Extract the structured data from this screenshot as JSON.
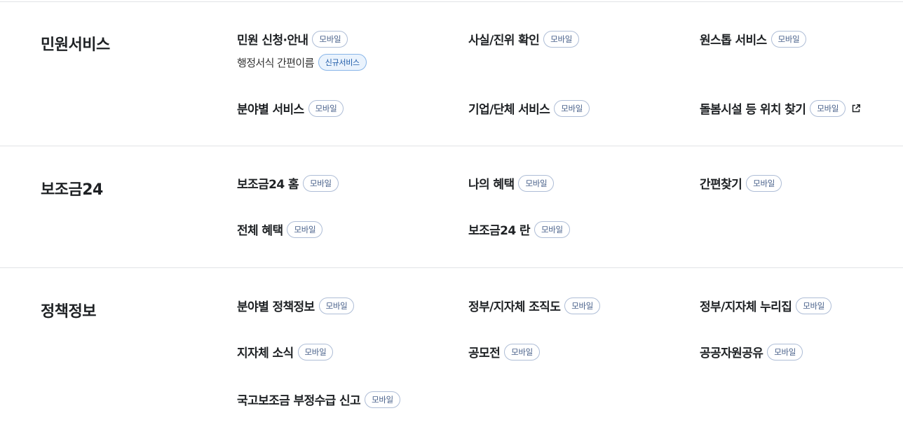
{
  "sections": [
    {
      "title": "민원서비스",
      "items": [
        {
          "label": "민원 신청·안내",
          "badge": "모바일"
        },
        {
          "label": "사실/진위 확인",
          "badge": "모바일"
        },
        {
          "label": "원스톱 서비스",
          "badge": "모바일"
        },
        {
          "label": "행정서식 간편이름",
          "badge": "신규서비스"
        },
        {
          "label": "분야별 서비스",
          "badge": "모바일"
        },
        {
          "label": "기업/단체 서비스",
          "badge": "모바일"
        },
        {
          "label": "돌봄시설 등 위치 찾기",
          "badge": "모바일",
          "icon": "external-link-icon"
        }
      ]
    },
    {
      "title": "보조금24",
      "items": [
        {
          "label": "보조금24 홈",
          "badge": "모바일"
        },
        {
          "label": "나의 혜택",
          "badge": "모바일"
        },
        {
          "label": "간편찾기",
          "badge": "모바일"
        },
        {
          "label": "전체 혜택",
          "badge": "모바일"
        },
        {
          "label": "보조금24 란",
          "badge": "모바일"
        }
      ]
    },
    {
      "title": "정책정보",
      "items": [
        {
          "label": "분야별 정책정보",
          "badge": "모바일"
        },
        {
          "label": "정부/지자체 조직도",
          "badge": "모바일"
        },
        {
          "label": "정부/지자체 누리집",
          "badge": "모바일"
        },
        {
          "label": "지자체 소식",
          "badge": "모바일"
        },
        {
          "label": "공모전",
          "badge": "모바일"
        },
        {
          "label": "공공자원공유",
          "badge": "모바일"
        },
        {
          "label": "국고보조금 부정수급 신고",
          "badge": "모바일"
        }
      ]
    }
  ]
}
